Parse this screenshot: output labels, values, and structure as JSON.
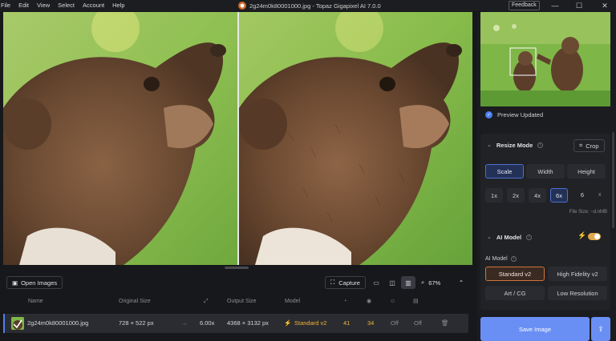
{
  "menu": [
    "File",
    "Edit",
    "View",
    "Select",
    "Account",
    "Help"
  ],
  "window": {
    "title": "2g24m0k80001000.jpg - Topaz Gigapixel AI 7.0.0",
    "feedback_label": "Feedback",
    "minimize": "—",
    "maximize": "☐",
    "close": "✕"
  },
  "sidebar": {
    "preview_updated": "Preview Updated",
    "resize_mode": {
      "title": "Resize Mode",
      "crop_label": "Crop",
      "tabs": [
        "Scale",
        "Width",
        "Height"
      ],
      "selected_tab": "Scale",
      "scales": [
        "1x",
        "2x",
        "4x",
        "6x"
      ],
      "selected_scale": "6x",
      "custom_scale": "6",
      "custom_scale_unit": "x",
      "file_size": "File Size: ~d.nMB"
    },
    "ai_model": {
      "title": "AI Model",
      "sub_label": "AI Model",
      "models": [
        "Standard v2",
        "High Fidelity v2",
        "Art / CG",
        "Low Resolution"
      ],
      "selected_model": "Standard v2"
    },
    "save_label": "Save Image"
  },
  "toolbar": {
    "open_images": "Open Images",
    "capture": "Capture",
    "zoom": "67%"
  },
  "table": {
    "headers": {
      "name": "Name",
      "original_size": "Original Size",
      "output_size": "Output Size",
      "model": "Model"
    },
    "rows": [
      {
        "name": "2g24m0k80001000.jpg",
        "original_size": "728 × 522 px",
        "scale": "6.00x",
        "output_size": "4368 × 3132 px",
        "model": "Standard v2",
        "v1": "41",
        "v2": "34",
        "v3": "Off",
        "v4": "Off"
      }
    ]
  },
  "icons": {
    "open_images": "image-icon",
    "capture": "capture-icon",
    "zoom": "zoom-icon",
    "crop": "crop-icon",
    "delete": "trash-icon",
    "export": "export-icon"
  },
  "colors": {
    "accent_blue": "#6a8ff4",
    "accent_orange": "#f0b43a",
    "selected_model_border": "#d0743a"
  }
}
